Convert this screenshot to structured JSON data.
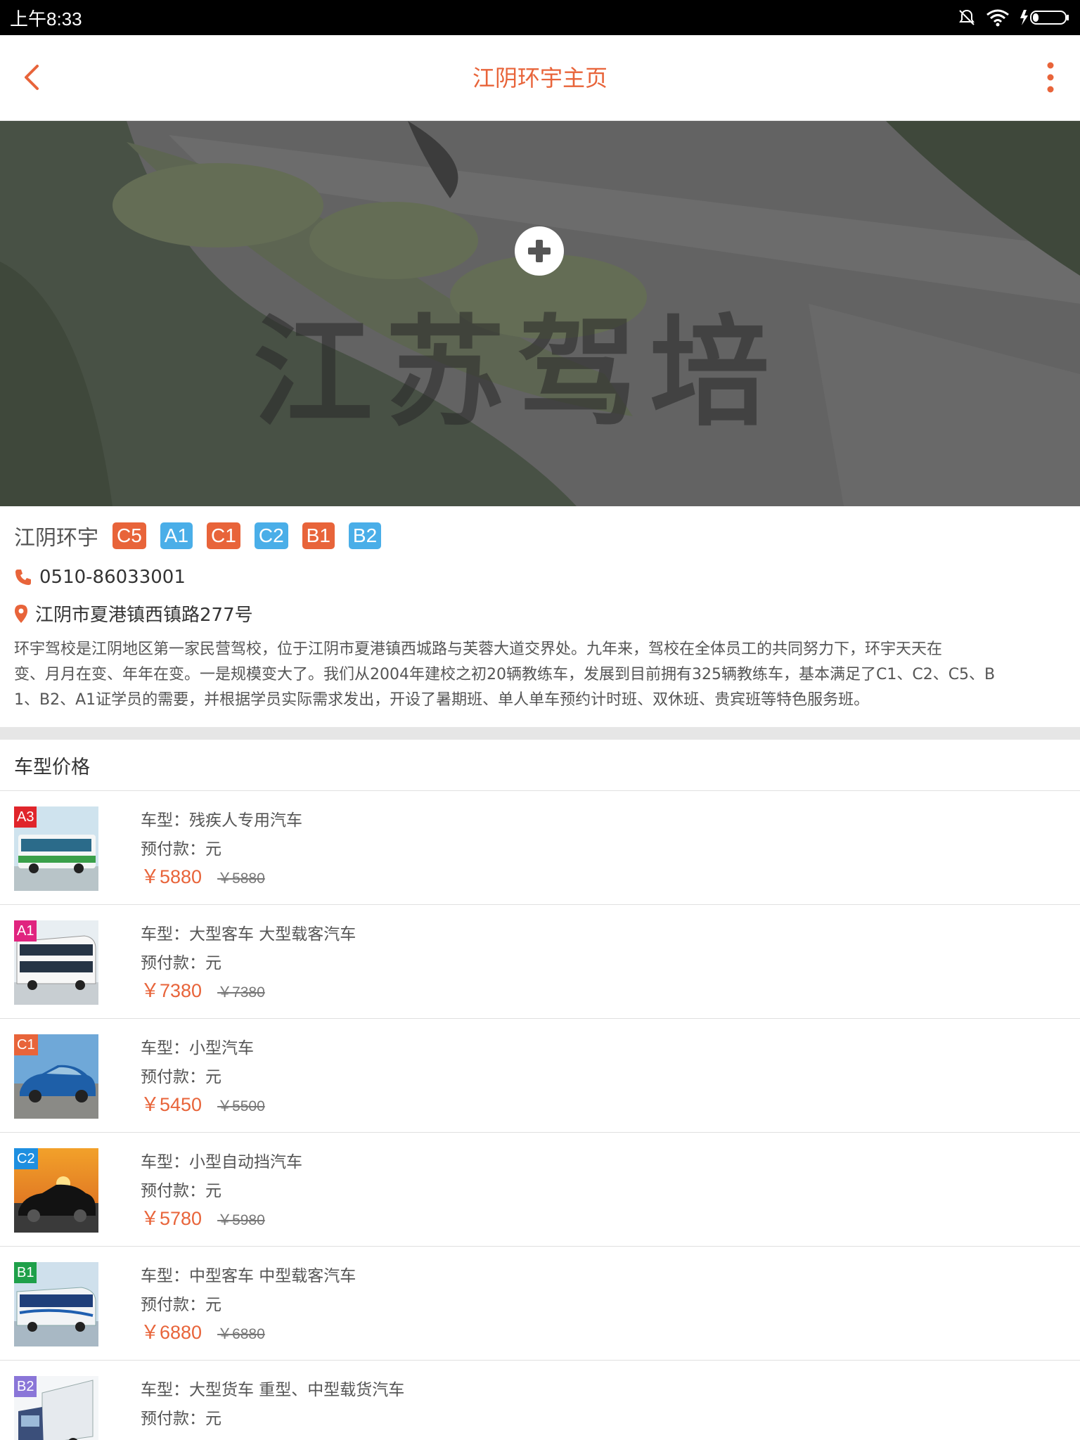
{
  "status_bar": {
    "time": "上午8:33"
  },
  "header": {
    "title": "江阴环宇主页"
  },
  "banner": {
    "watermark": "江苏驾培"
  },
  "school": {
    "name": "江阴环宇",
    "badges": [
      {
        "label": "C5",
        "color": "#e8643a"
      },
      {
        "label": "A1",
        "color": "#4aaee8"
      },
      {
        "label": "C1",
        "color": "#e8643a"
      },
      {
        "label": "C2",
        "color": "#4aaee8"
      },
      {
        "label": "B1",
        "color": "#e8643a"
      },
      {
        "label": "B2",
        "color": "#4aaee8"
      }
    ],
    "phone": "0510-86033001",
    "address": "江阴市夏港镇西镇路277号",
    "description_lines": [
      "环宇驾校是江阴地区第一家民营驾校，位于江阴市夏港镇西城路与芙蓉大道交界处。九年来，驾校在全体员工的共同努力下，环宇天天在",
      "变、月月在变、年年在变。一是规模变大了。我们从2004年建校之初20辆教练车，发展到目前拥有325辆教练车，基本满足了C1、C2、C5、B",
      "1、B2、A1证学员的需要，并根据学员实际需求发出，开设了暑期班、单人单车预约计时班、双休班、贵宾班等特色服务班。"
    ]
  },
  "price_section": {
    "title": "车型价格"
  },
  "car_types": [
    {
      "tag": "A3",
      "tag_color": "#e0252b",
      "type_line": "车型：残疾人专用汽车",
      "prepay_line": "预付款：元",
      "price": "￥5880",
      "original": "￥5880"
    },
    {
      "tag": "A1",
      "tag_color": "#e0247f",
      "type_line": "车型：大型客车 大型载客汽车",
      "prepay_line": "预付款：元",
      "price": "￥7380",
      "original": "￥7380"
    },
    {
      "tag": "C1",
      "tag_color": "#e8643a",
      "type_line": "车型：小型汽车",
      "prepay_line": "预付款：元",
      "price": "￥5450",
      "original": "￥5500"
    },
    {
      "tag": "C2",
      "tag_color": "#1e8fe0",
      "type_line": "车型：小型自动挡汽车",
      "prepay_line": "预付款：元",
      "price": "￥5780",
      "original": "￥5980"
    },
    {
      "tag": "B1",
      "tag_color": "#1fa04a",
      "type_line": "车型：中型客车 中型载客汽车",
      "prepay_line": "预付款：元",
      "price": "￥6880",
      "original": "￥6880"
    },
    {
      "tag": "B2",
      "tag_color": "#8a76d8",
      "type_line": "车型：大型货车 重型、中型载货汽车",
      "prepay_line": "预付款：元",
      "price": "",
      "original": ""
    }
  ],
  "colors": {
    "accent": "#e8643a",
    "badge_blue": "#4aaee8"
  }
}
